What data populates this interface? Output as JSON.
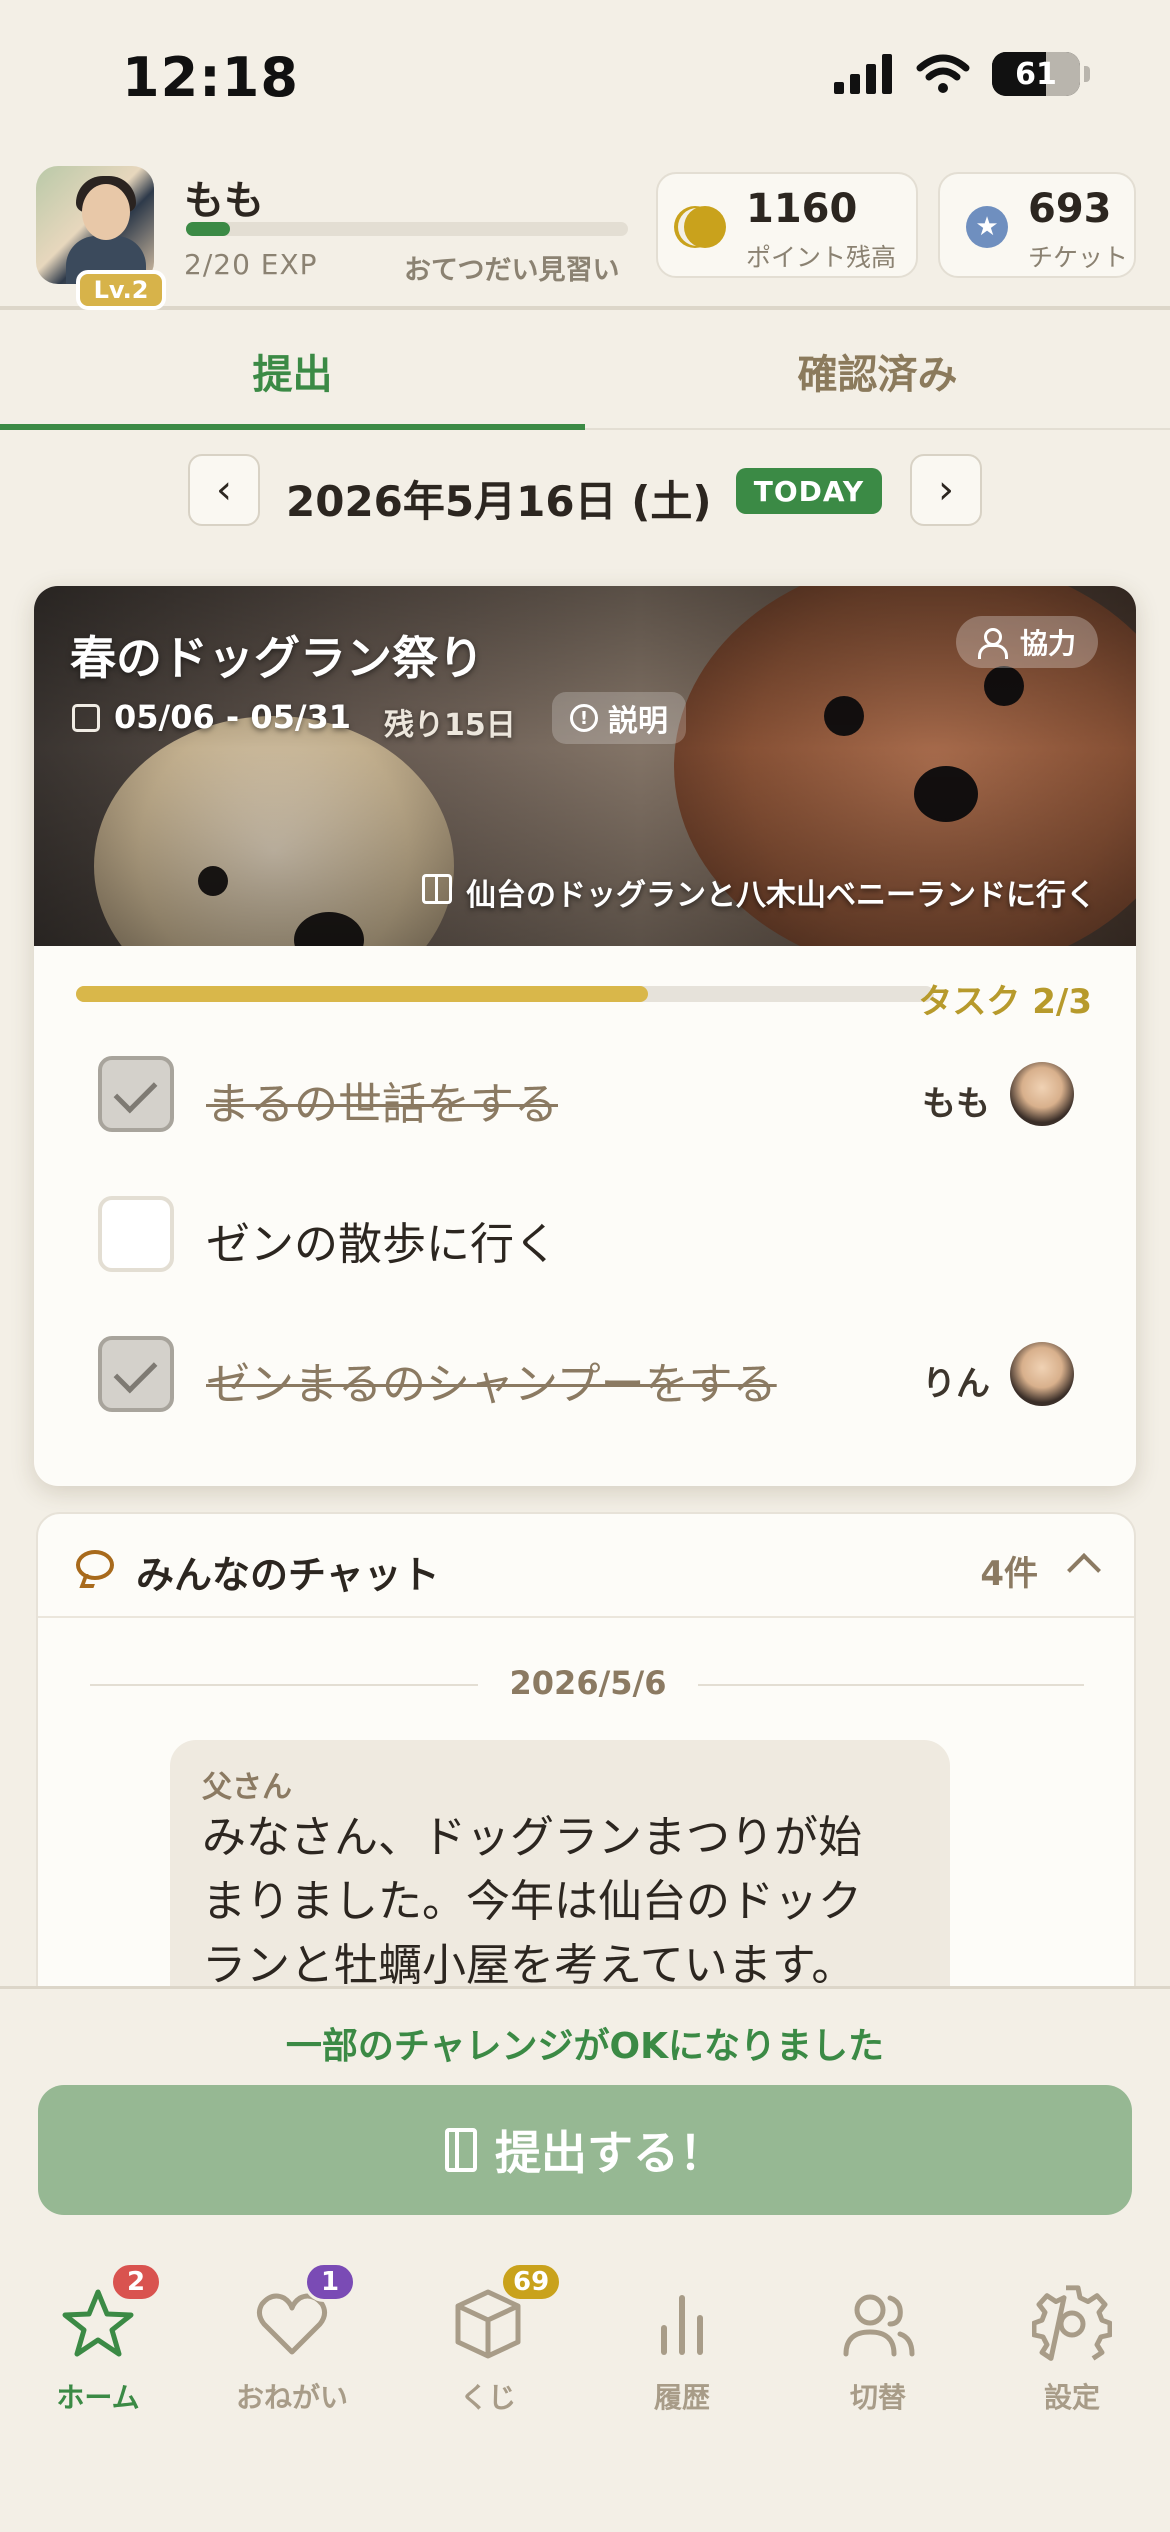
{
  "status": {
    "time": "12:18",
    "battery": "61",
    "battery_level": 0.61
  },
  "profile": {
    "name": "もも",
    "level_badge": "Lv.2",
    "exp_text": "2/20 EXP",
    "exp_fraction": 0.1,
    "rank": "おてつだい見習い"
  },
  "stats": {
    "points_value": "1160",
    "points_label": "ポイント残高",
    "tickets_value": "693",
    "tickets_label": "チケット"
  },
  "tabs": [
    {
      "label": "提出",
      "active": true
    },
    {
      "label": "確認済み",
      "active": false
    }
  ],
  "date_nav": {
    "prev": "‹",
    "date": "2026年5月16日 (土)",
    "today": "TODAY",
    "next": "›"
  },
  "event": {
    "title": "春のドッグラン祭り",
    "dates": "05/06 - 05/31",
    "remaining": "残り15日",
    "info_label": "説明",
    "coop_label": "協力",
    "reward": "仙台のドッグランと八木山ベニーランドに行く",
    "progress_fraction": 0.667,
    "task_count": "タスク 2/3",
    "tasks": [
      {
        "label": "まるの世話をする",
        "done": true,
        "user": "もも"
      },
      {
        "label": "ゼンの散歩に行く",
        "done": false,
        "user": ""
      },
      {
        "label": "ゼンまるのシャンプーをする",
        "done": true,
        "user": "りん"
      }
    ]
  },
  "chat": {
    "title": "みんなのチャット",
    "count": "4件",
    "date": "2026/5/6",
    "message_sender": "父さん",
    "message_text": "みなさん、ドッグランまつりが始まりました。今年は仙台のドックランと牡蠣小屋を考えています。"
  },
  "submit": {
    "note": "一部のチャレンジがOKになりました",
    "button_label": "提出する！"
  },
  "nav": [
    {
      "label": "ホーム",
      "icon": "star-icon",
      "badge": "2",
      "badge_color": "#d9534f",
      "active": true
    },
    {
      "label": "おねがい",
      "icon": "heart-icon",
      "badge": "1",
      "badge_color": "#7a4bb5",
      "active": false
    },
    {
      "label": "くじ",
      "icon": "box-icon",
      "badge": "69",
      "badge_color": "#c9a21c",
      "active": false
    },
    {
      "label": "履歴",
      "icon": "bar-chart-icon",
      "badge": "",
      "active": false
    },
    {
      "label": "切替",
      "icon": "users-icon",
      "badge": "",
      "active": false
    },
    {
      "label": "設定",
      "icon": "gear-icon",
      "badge": "",
      "active": false
    }
  ],
  "colors": {
    "accent_green": "#3b8a45",
    "gold": "#d9b74a",
    "background": "#f3efe6"
  }
}
